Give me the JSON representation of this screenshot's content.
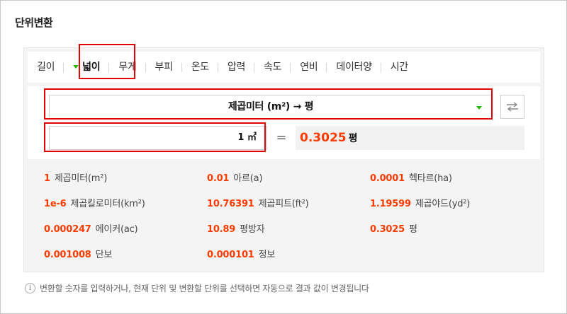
{
  "title": "단위변환",
  "tabs": [
    {
      "label": "길이"
    },
    {
      "label": "넓이",
      "active": true
    },
    {
      "label": "무게"
    },
    {
      "label": "부피"
    },
    {
      "label": "온도"
    },
    {
      "label": "압력"
    },
    {
      "label": "속도"
    },
    {
      "label": "연비"
    },
    {
      "label": "데이터양"
    },
    {
      "label": "시간"
    }
  ],
  "converter": {
    "selected": "제곱미터 (m²) → 평",
    "input_value": "1 ㎡",
    "equals": "=",
    "result_value": "0.3025",
    "result_unit": "평"
  },
  "results": [
    {
      "value": "1",
      "unit": "제곱미터(m²)"
    },
    {
      "value": "0.01",
      "unit": "아르(a)"
    },
    {
      "value": "0.0001",
      "unit": "헥타르(ha)"
    },
    {
      "value": "1e-6",
      "unit": "제곱킬로미터(km²)"
    },
    {
      "value": "10.76391",
      "unit": "제곱피트(ft²)"
    },
    {
      "value": "1.19599",
      "unit": "제곱야드(yd²)"
    },
    {
      "value": "0.000247",
      "unit": "에이커(ac)"
    },
    {
      "value": "10.89",
      "unit": "평방자"
    },
    {
      "value": "0.3025",
      "unit": "평"
    },
    {
      "value": "0.001008",
      "unit": "단보"
    },
    {
      "value": "0.000101",
      "unit": "정보"
    }
  ],
  "footer": {
    "info_icon": "i",
    "text": "변환할 숫자를 입력하거나, 현재 단위 및 변환할 단위를 선택하면 자동으로 결과 값이 변경됩니다"
  },
  "colors": {
    "accent_green": "#2db400",
    "value_red": "#ff3c00",
    "highlight_red": "#e10000"
  }
}
